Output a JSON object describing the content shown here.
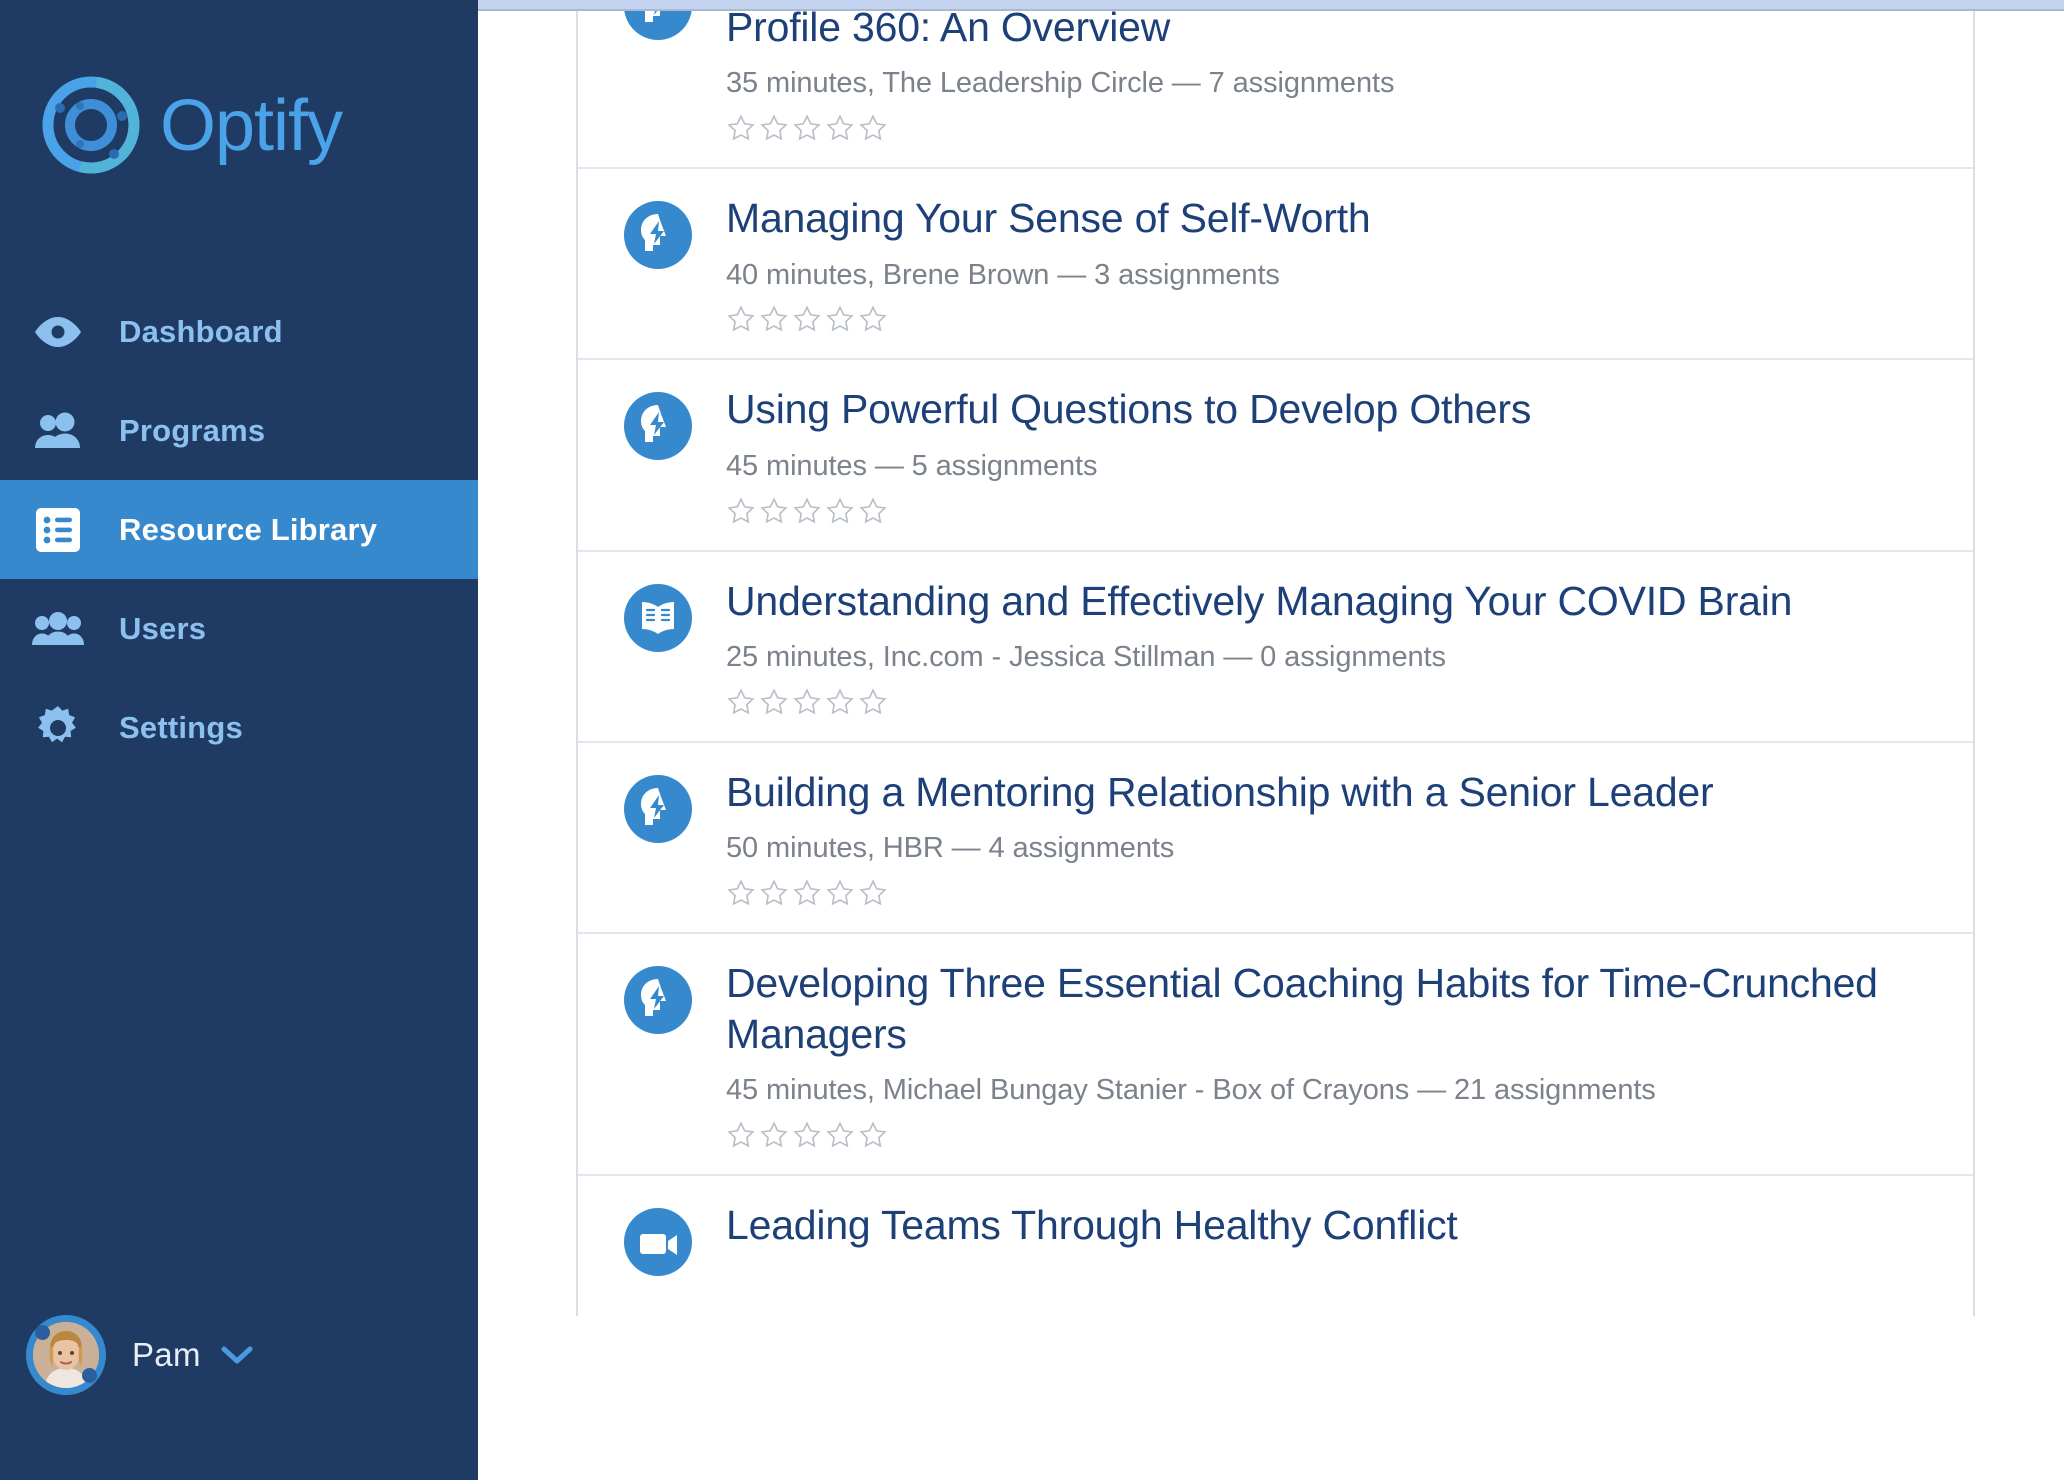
{
  "app": {
    "brand_name": "Optify",
    "brand_logo_icon": "optify-target-logo"
  },
  "sidebar": {
    "items": [
      {
        "label": "Dashboard",
        "icon": "eye-icon",
        "active": false
      },
      {
        "label": "Programs",
        "icon": "two-people-icon",
        "active": false
      },
      {
        "label": "Resource Library",
        "icon": "list-icon",
        "active": true
      },
      {
        "label": "Users",
        "icon": "three-people-icon",
        "active": false
      },
      {
        "label": "Settings",
        "icon": "gear-icon",
        "active": false
      }
    ],
    "profile": {
      "name": "Pam",
      "avatar_icon": "user-avatar-photo",
      "caret_icon": "chevron-down-icon"
    }
  },
  "colors": {
    "sidebar_bg": "#1f3b63",
    "accent_blue": "#3689cd",
    "nav_inactive_text": "#8cc0ef",
    "title_blue": "#1d4078",
    "meta_gray": "#7b828c",
    "divider": "#e3e7ec",
    "top_strip": "#c3d3f0"
  },
  "main": {
    "resources": [
      {
        "title": "Profile 360: An Overview",
        "meta": "35 minutes, The Leadership Circle — 7 assignments",
        "icon": "brain-lightning-icon",
        "rating": 0,
        "max_rating": 5,
        "clipped": "top"
      },
      {
        "title": "Managing Your Sense of Self-Worth",
        "meta": "40 minutes, Brene Brown — 3 assignments",
        "icon": "brain-lightning-icon",
        "rating": 0,
        "max_rating": 5
      },
      {
        "title": "Using Powerful Questions to Develop Others",
        "meta": "45 minutes — 5 assignments",
        "icon": "brain-lightning-icon",
        "rating": 0,
        "max_rating": 5
      },
      {
        "title": "Understanding and Effectively Managing Your COVID Brain",
        "meta": "25 minutes, Inc.com - Jessica Stillman — 0 assignments",
        "icon": "open-book-icon",
        "rating": 0,
        "max_rating": 5
      },
      {
        "title": "Building a Mentoring Relationship with a Senior Leader",
        "meta": "50 minutes, HBR — 4 assignments",
        "icon": "brain-lightning-icon",
        "rating": 0,
        "max_rating": 5
      },
      {
        "title": "Developing Three Essential Coaching Habits for Time-Crunched Managers",
        "meta": "45 minutes, Michael Bungay Stanier - Box of Crayons — 21 assignments",
        "icon": "brain-lightning-icon",
        "rating": 0,
        "max_rating": 5
      },
      {
        "title": "Leading Teams Through Healthy Conflict",
        "meta": "",
        "icon": "video-camera-icon",
        "rating": 0,
        "max_rating": 5,
        "clipped": "bottom"
      }
    ]
  }
}
